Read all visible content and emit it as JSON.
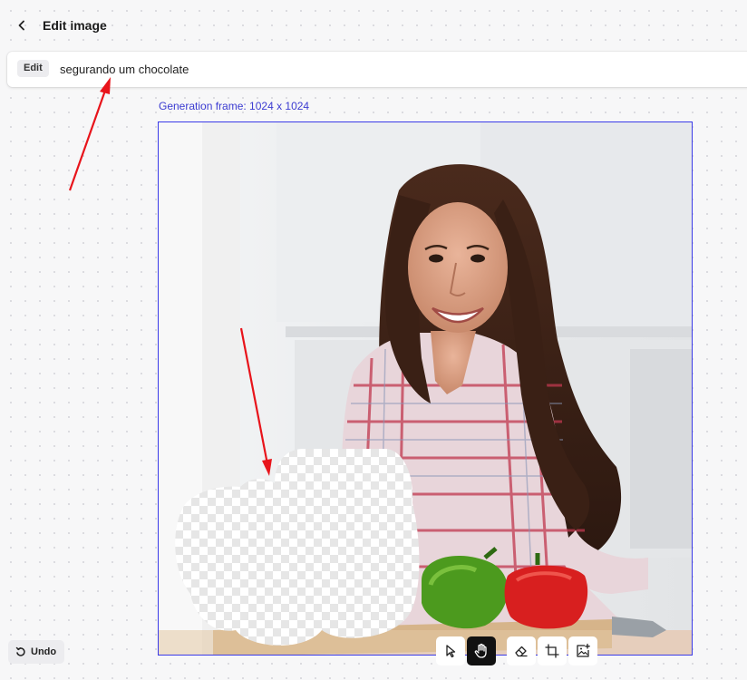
{
  "header": {
    "title": "Edit image",
    "back_icon": "chevron-left-icon"
  },
  "prompt": {
    "mode_label": "Edit",
    "value": "segurando um chocolate"
  },
  "canvas": {
    "frame_label": "Generation frame: 1024 x 1024",
    "frame_color": "#3a3ae8"
  },
  "footer": {
    "undo_label": "Undo",
    "undo_icon": "undo-icon"
  },
  "toolbar": {
    "tools": [
      {
        "name": "select-tool",
        "icon": "cursor-arrow-icon",
        "active": false
      },
      {
        "name": "pan-tool",
        "icon": "hand-icon",
        "active": true
      },
      {
        "name": "eraser-tool",
        "icon": "eraser-icon",
        "active": false
      },
      {
        "name": "crop-tool",
        "icon": "crop-frame-icon",
        "active": false
      },
      {
        "name": "add-image-tool",
        "icon": "image-plus-icon",
        "active": false
      }
    ]
  },
  "colors": {
    "accent": "#3b3bd1",
    "annotation_arrow": "#e8141b",
    "active_tool": "#111111"
  }
}
